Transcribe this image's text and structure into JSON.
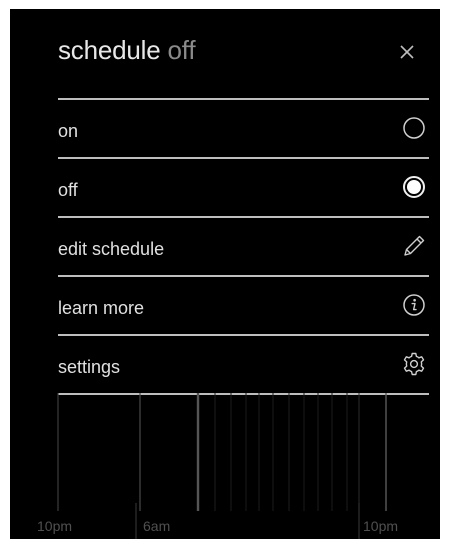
{
  "header": {
    "title": "schedule",
    "state": "off"
  },
  "menu": {
    "items": [
      {
        "label": "on",
        "icon": "radio-unselected-icon"
      },
      {
        "label": "off",
        "icon": "radio-selected-icon"
      },
      {
        "label": "edit schedule",
        "icon": "pencil-icon"
      },
      {
        "label": "learn more",
        "icon": "info-icon"
      },
      {
        "label": "settings",
        "icon": "gear-icon"
      }
    ]
  },
  "timeline": {
    "labels": [
      "10pm",
      "6am",
      "10pm"
    ]
  },
  "colors": {
    "background": "#000000",
    "divider": "#bdbdbd",
    "text": "#e0e0e0",
    "muted": "#8a8a8a"
  }
}
